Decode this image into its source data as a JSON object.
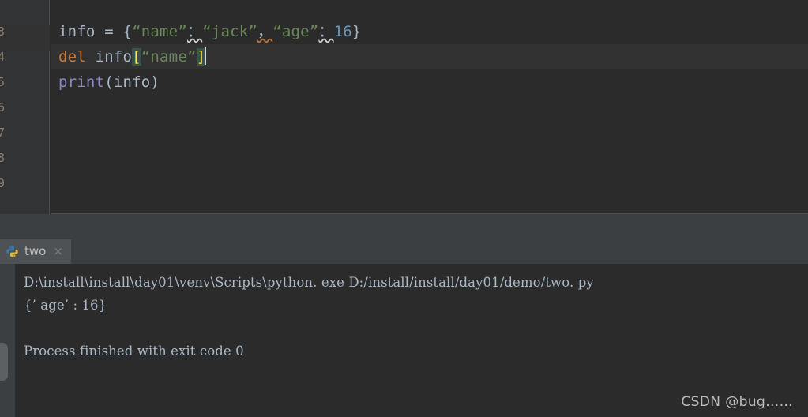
{
  "editor": {
    "background_color": "#2b2b2b",
    "gutter_color": "#313335",
    "current_line_color": "#323232",
    "gutter_line_numbers": [
      "3",
      "4",
      "5",
      "6",
      "7",
      "8",
      "9"
    ],
    "lines": [
      {
        "id": "line-assign",
        "is_current": false,
        "tokens": [
          {
            "text": "info",
            "type": "identifier",
            "color": "#a9b7c6"
          },
          {
            "text": " = ",
            "type": "operator",
            "color": "#a9b7c6"
          },
          {
            "text": "{",
            "type": "brace",
            "color": "#a9b7c6"
          },
          {
            "text": "“name”",
            "type": "string",
            "color": "#6a8759"
          },
          {
            "text": "：",
            "type": "punct-warning",
            "color": "#a9b7c6"
          },
          {
            "text": "“jack”",
            "type": "string",
            "color": "#6a8759"
          },
          {
            "text": "，",
            "type": "comma-warning",
            "color": "#a9b7c6"
          },
          {
            "text": "“age”",
            "type": "string",
            "color": "#6a8759"
          },
          {
            "text": "：",
            "type": "punct-warning",
            "color": "#a9b7c6"
          },
          {
            "text": "16",
            "type": "number",
            "color": "#6897bb"
          },
          {
            "text": "}",
            "type": "brace",
            "color": "#a9b7c6"
          }
        ]
      },
      {
        "id": "line-del",
        "is_current": true,
        "tokens": [
          {
            "text": "del",
            "type": "keyword",
            "color": "#cc7832"
          },
          {
            "text": " ",
            "type": "operator",
            "color": "#a9b7c6"
          },
          {
            "text": "info",
            "type": "identifier",
            "color": "#a9b7c6"
          },
          {
            "text": "[",
            "type": "brace-match",
            "color": "#ffe14d"
          },
          {
            "text": "“name”",
            "type": "string",
            "color": "#6a8759"
          },
          {
            "text": "]",
            "type": "brace-match",
            "color": "#ffe14d"
          }
        ]
      },
      {
        "id": "line-print",
        "is_current": false,
        "tokens": [
          {
            "text": "print",
            "type": "builtin",
            "color": "#8888c6"
          },
          {
            "text": "(",
            "type": "brace",
            "color": "#a9b7c6"
          },
          {
            "text": "info",
            "type": "identifier",
            "color": "#a9b7c6"
          },
          {
            "text": ")",
            "type": "brace",
            "color": "#a9b7c6"
          }
        ]
      }
    ]
  },
  "console": {
    "tab": {
      "label": "two",
      "icon": "python-logo-icon",
      "close_label": "×"
    },
    "output": {
      "command_line": "D:\\install\\install\\day01\\venv\\Scripts\\python. exe D:/install/install/day01/demo/two. py",
      "result_line": "{’ age’ : 16}",
      "blank_line": "",
      "finish_line": "Process finished with exit code 0"
    },
    "background_color": "#2b2b2b",
    "panel_color": "#3c3f41"
  },
  "watermark": {
    "text": "CSDN @bug……"
  }
}
